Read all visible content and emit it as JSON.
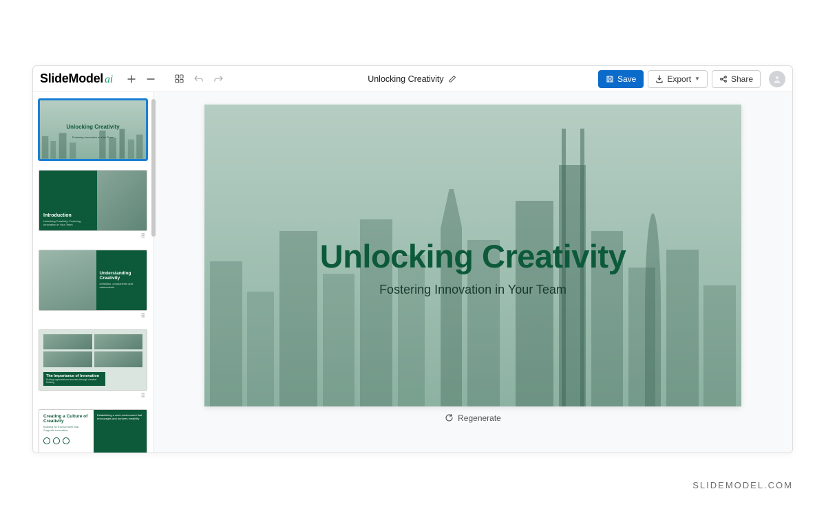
{
  "logo": {
    "main": "SlideModel",
    "suffix": "ai"
  },
  "document": {
    "title": "Unlocking Creativity"
  },
  "toolbar": {
    "save": "Save",
    "export": "Export",
    "share": "Share"
  },
  "main_slide": {
    "title": "Unlocking Creativity",
    "subtitle": "Fostering Innovation in Your Team"
  },
  "regenerate_label": "Regenerate",
  "thumbnails": [
    {
      "title": "Unlocking Creativity",
      "subtitle": "Fostering Innovation in Your Team",
      "selected": true
    },
    {
      "title": "Introduction",
      "subtitle": "Unlocking Creativity: Fostering Innovation in Your Team"
    },
    {
      "title": "Understanding Creativity",
      "subtitle": "Definition, components and antecedents"
    },
    {
      "title": "The Importance of Innovation",
      "subtitle": "Driving organizational success through creative thinking"
    },
    {
      "title": "Creating a Culture of Creativity",
      "subtitle": "Building an Environment that Supports Innovation",
      "right_text": "Establishing a work environment that encourages and nurtures creativity"
    }
  ],
  "thumb_badge": "⠿",
  "watermark": "SLIDEMODEL.COM"
}
